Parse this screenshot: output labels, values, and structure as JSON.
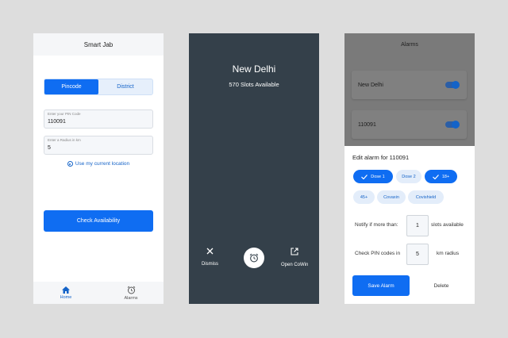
{
  "screen1": {
    "title": "Smart Jab",
    "tabs": {
      "pincode": "Pincode",
      "district": "District"
    },
    "pin_field": {
      "label": "Enter your PIN Code",
      "value": "110091"
    },
    "radius_field": {
      "label": "Enter a Radius in km",
      "value": "5"
    },
    "location_link": "Use my current location",
    "check_button": "Check Availability",
    "nav": {
      "home": "Home",
      "alarms": "Alarms"
    }
  },
  "screen2": {
    "city": "New Delhi",
    "slots": "570 Slots Available",
    "dismiss": "Dismiss",
    "open_cowin": "Open CoWin"
  },
  "screen3": {
    "title": "Alarms",
    "alarms": [
      {
        "name": "New Delhi",
        "enabled": true
      },
      {
        "name": "110091",
        "enabled": true
      }
    ],
    "sheet_title": "Edit alarm for 110091",
    "chips": {
      "dose1": "Dose 1",
      "dose2": "Dose 2",
      "age18": "18+",
      "age45": "45+",
      "covaxin": "Covaxin",
      "covishield": "Covishield"
    },
    "notify": {
      "prefix": "Notify if more than:",
      "value": "1",
      "suffix": "slots available"
    },
    "pin_radius": {
      "prefix": "Check PIN codes in",
      "value": "5",
      "suffix": "km radius"
    },
    "save_button": "Save Alarm",
    "delete_button": "Delete"
  },
  "colors": {
    "primary": "#0f6df2",
    "dark_bg": "#34404a",
    "light_chip": "#e3edfa"
  }
}
